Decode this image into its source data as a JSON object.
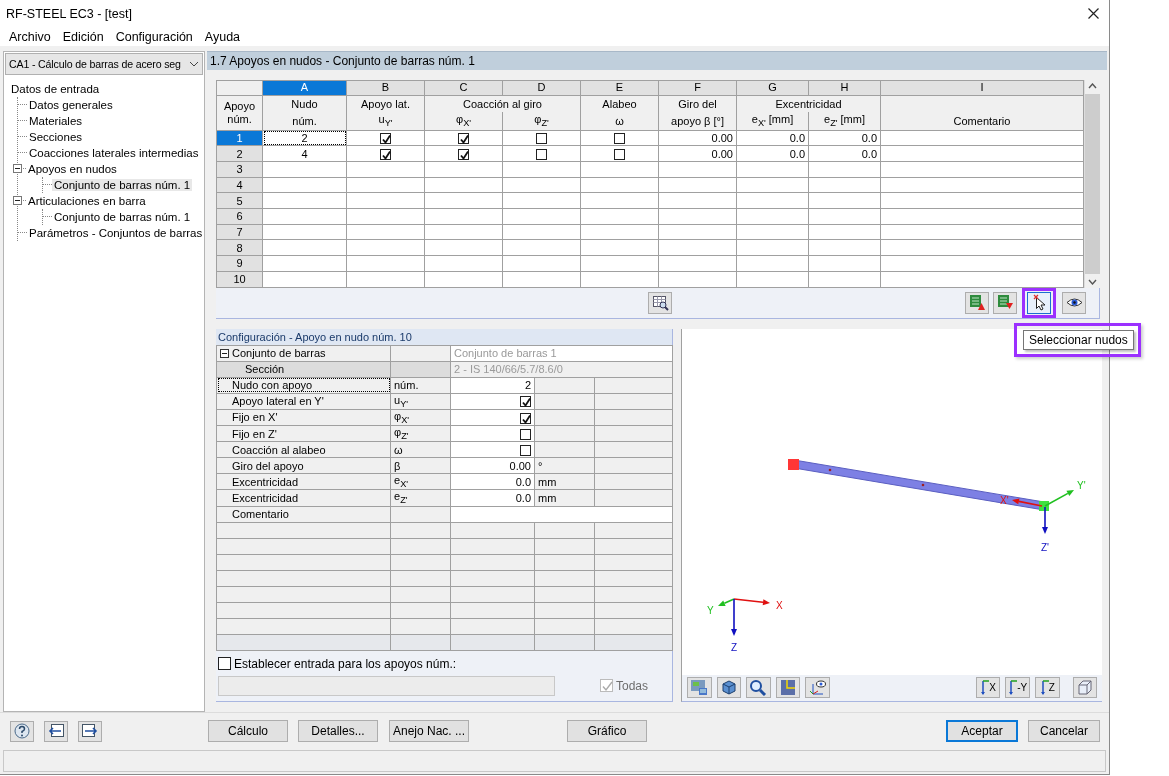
{
  "window": {
    "title": "RF-STEEL EC3 - [test]"
  },
  "menu": [
    {
      "label": "Archivo"
    },
    {
      "label": "Edición"
    },
    {
      "label": "Configuración"
    },
    {
      "label": "Ayuda"
    }
  ],
  "case_selector": {
    "value": "CA1 - Cálculo de barras de acero seg"
  },
  "navigator": {
    "items": [
      {
        "label": "Datos de entrada",
        "selected": false,
        "children": [
          {
            "label": "Datos generales",
            "selected": false
          },
          {
            "label": "Materiales",
            "selected": false
          },
          {
            "label": "Secciones",
            "selected": false
          },
          {
            "label": "Coacciones laterales intermedias",
            "selected": false
          },
          {
            "label": "Apoyos en nudos",
            "selected": false,
            "expanded": true,
            "children": [
              {
                "label": "Conjunto de barras núm. 1",
                "selected": true
              }
            ]
          },
          {
            "label": "Articulaciones en barra",
            "selected": false,
            "expanded": true,
            "children": [
              {
                "label": "Conjunto de barras núm. 1",
                "selected": false
              }
            ]
          },
          {
            "label": "Parámetros - Conjuntos de barras",
            "selected": false
          }
        ]
      }
    ]
  },
  "section": {
    "title": "1.7 Apoyos en nudos - Conjunto de barras núm. 1"
  },
  "table": {
    "corner": "Apoyo núm.",
    "groups": [
      {
        "title": "Nudo",
        "columns": [
          {
            "letter": "A",
            "selected": true,
            "sub": "núm.",
            "kind": "id"
          }
        ]
      },
      {
        "title": "Apoyo lat.",
        "columns": [
          {
            "letter": "B",
            "selected": false,
            "sub": "u$_{Y'}$",
            "kind": "check"
          }
        ]
      },
      {
        "title": "Coacción al giro",
        "columns": [
          {
            "letter": "C",
            "selected": false,
            "sub": "φ$_{X'}$",
            "kind": "check"
          },
          {
            "letter": "D",
            "selected": false,
            "sub": "φ$_{Z'}$",
            "kind": "check"
          }
        ]
      },
      {
        "title": "Alabeo",
        "columns": [
          {
            "letter": "E",
            "selected": false,
            "sub": "ω",
            "kind": "check"
          }
        ]
      },
      {
        "title": "Giro del",
        "columns": [
          {
            "letter": "F",
            "selected": false,
            "sub": "apoyo β [°]",
            "kind": "number"
          }
        ]
      },
      {
        "title": "Excentricidad",
        "columns": [
          {
            "letter": "G",
            "selected": false,
            "sub": "e$_{X'}$ [mm]",
            "kind": "number"
          },
          {
            "letter": "H",
            "selected": false,
            "sub": "e$_{Z'}$ [mm]",
            "kind": "number"
          }
        ]
      },
      {
        "columns": [
          {
            "letter": "I",
            "selected": false,
            "sub": "Comentario",
            "kind": "text"
          }
        ]
      }
    ],
    "rows": [
      {
        "num": "1",
        "selected": true,
        "cells": [
          {
            "value": "2",
            "focused": true
          },
          {
            "checked": true
          },
          {
            "checked": true
          },
          {
            "checked": false
          },
          {
            "checked": false
          },
          {
            "value": "0.00"
          },
          {
            "value": "0.0"
          },
          {
            "value": "0.0"
          }
        ]
      },
      {
        "num": "2",
        "selected": false,
        "cells": [
          {
            "value": "4",
            "focused": false
          },
          {
            "checked": true
          },
          {
            "checked": true
          },
          {
            "checked": false
          },
          {
            "checked": false
          },
          {
            "value": "0.00"
          },
          {
            "value": "0.0"
          },
          {
            "value": "0.0"
          }
        ]
      },
      {
        "num": "3",
        "selected": false
      },
      {
        "num": "4",
        "selected": false
      },
      {
        "num": "5",
        "selected": false
      },
      {
        "num": "6",
        "selected": false
      },
      {
        "num": "7",
        "selected": false
      },
      {
        "num": "8",
        "selected": false
      },
      {
        "num": "9",
        "selected": false
      },
      {
        "num": "10",
        "selected": false
      }
    ]
  },
  "table_tools": [
    {
      "kind": "table-view",
      "highlighted": false,
      "pressed": false
    },
    {
      "kind": "excel-export",
      "highlighted": false,
      "pressed": false
    },
    {
      "kind": "excel-import",
      "highlighted": false,
      "pressed": false
    },
    {
      "kind": "select-nodes",
      "highlighted": true,
      "pressed": true
    },
    {
      "kind": "view",
      "highlighted": false,
      "pressed": false
    }
  ],
  "tooltip": {
    "text": "Seleccionar nudos",
    "highlighted": true
  },
  "config": {
    "title": "Configuración - Apoyo en nudo núm. 10",
    "rows": [
      {
        "kind": "group",
        "label": "Conjunto de barras",
        "expanded": true,
        "value": "Conjunto de barras 1"
      },
      {
        "kind": "info",
        "label": "Sección",
        "value": "2 - IS 140/66/5.7/8.6/0"
      },
      {
        "kind": "number",
        "label": "Nudo con apoyo",
        "symbol": "núm.",
        "value": "2",
        "focused": true
      },
      {
        "kind": "check",
        "label": "Apoyo lateral en Y'",
        "symbol": "u$_{Y'}$",
        "checked": true
      },
      {
        "kind": "check",
        "label": "Fijo en X'",
        "symbol": "φ$_{X'}$",
        "checked": true
      },
      {
        "kind": "check",
        "label": "Fijo en Z'",
        "symbol": "φ$_{Z'}$",
        "checked": false
      },
      {
        "kind": "check",
        "label": "Coacción al alabeo",
        "symbol": "ω",
        "checked": false
      },
      {
        "kind": "number",
        "label": "Giro del apoyo",
        "symbol": "β",
        "value": "0.00",
        "unit": "°",
        "focused": false
      },
      {
        "kind": "number",
        "label": "Excentricidad",
        "symbol": "e$_{X'}$",
        "value": "0.0",
        "unit": "mm",
        "focused": false
      },
      {
        "kind": "number",
        "label": "Excentricidad",
        "symbol": "e$_{Z'}$",
        "value": "0.0",
        "unit": "mm",
        "focused": false
      },
      {
        "kind": "text",
        "label": "Comentario"
      }
    ]
  },
  "apply_to": {
    "label": "Establecer entrada para los apoyos núm.:",
    "checked": false,
    "field": {
      "disabled": true
    },
    "all": {
      "label": "Todas",
      "checked": true,
      "disabled": true
    }
  },
  "view": {
    "local_axes": {
      "x": "X'",
      "y": "Y'",
      "z": "Z'"
    },
    "global_axes": {
      "x": "X",
      "y": "Y",
      "z": "Z"
    },
    "tools_left": [
      {
        "kind": "display"
      },
      {
        "kind": "views"
      },
      {
        "kind": "zoom"
      },
      {
        "kind": "panel"
      },
      {
        "kind": "axes"
      }
    ],
    "tools_right": [
      {
        "kind": "view-x",
        "label": "X"
      },
      {
        "kind": "view-y",
        "label": "-Y"
      },
      {
        "kind": "view-z",
        "label": "Z"
      },
      {
        "kind": "iso"
      }
    ]
  },
  "footer": {
    "icon_buttons": [
      {
        "kind": "help"
      },
      {
        "kind": "previous"
      },
      {
        "kind": "next"
      }
    ],
    "buttons": [
      {
        "label": "Cálculo",
        "default": false
      },
      {
        "label": "Detalles...",
        "default": false
      },
      {
        "label": "Anejo Nac. ...",
        "default": false
      },
      {
        "label": "Gráfico",
        "default": false
      },
      {
        "label": "Aceptar",
        "default": true
      },
      {
        "label": "Cancelar",
        "default": false
      }
    ]
  }
}
